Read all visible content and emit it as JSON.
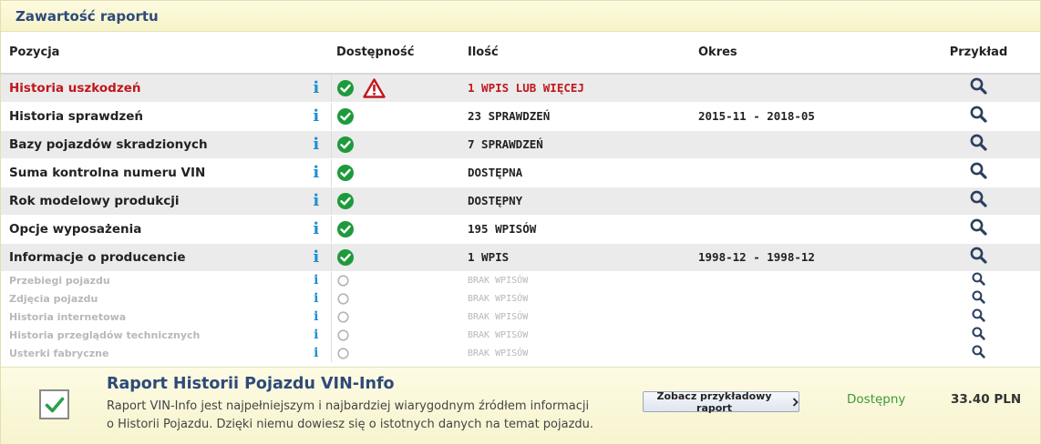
{
  "header": {
    "title": "Zawartość raportu"
  },
  "columns": {
    "position": "Pozycja",
    "availability": "Dostępność",
    "quantity": "Ilość",
    "period": "Okres",
    "example": "Przykład"
  },
  "rows": [
    {
      "name": "Historia uszkodzeń",
      "quantity": "1 WPIS LUB WIĘCEJ",
      "period": ""
    },
    {
      "name": "Historia sprawdzeń",
      "quantity": "23 SPRAWDZEŃ",
      "period": "2015-11 - 2018-05"
    },
    {
      "name": "Bazy pojazdów skradzionych",
      "quantity": "7 SPRAWDZEŃ",
      "period": ""
    },
    {
      "name": "Suma kontrolna numeru VIN",
      "quantity": "DOSTĘPNA",
      "period": ""
    },
    {
      "name": "Rok modelowy produkcji",
      "quantity": "DOSTĘPNY",
      "period": ""
    },
    {
      "name": "Opcje wyposażenia",
      "quantity": "195 WPISÓW",
      "period": ""
    },
    {
      "name": "Informacje o producencie",
      "quantity": "1 WPIS",
      "period": "1998-12 - 1998-12"
    },
    {
      "name": "Przebiegi pojazdu",
      "quantity": "BRAK WPISÓW",
      "period": ""
    },
    {
      "name": "Zdjęcia pojazdu",
      "quantity": "BRAK WPISÓW",
      "period": ""
    },
    {
      "name": "Historia internetowa",
      "quantity": "BRAK WPISÓW",
      "period": ""
    },
    {
      "name": "Historia przeglądów technicznych",
      "quantity": "BRAK WPISÓW",
      "period": ""
    },
    {
      "name": "Usterki fabryczne",
      "quantity": "BRAK WPISÓW",
      "period": ""
    }
  ],
  "footer": {
    "title": "Raport Historii Pojazdu VIN-Info",
    "desc_line1": "Raport VIN-Info jest najpełniejszym i najbardziej wiarygodnym źródłem informacji",
    "desc_line2": "o Historii Pojazdu. Dzięki niemu dowiesz się o istotnych danych na temat pojazdu.",
    "sample_button": "Zobacz przykładowy raport",
    "availability": "Dostępny",
    "price": "33.40 PLN"
  },
  "icons": {
    "info": "info-icon",
    "available": "check-circle-icon",
    "unavailable": "empty-circle-icon",
    "warning": "warning-triangle-icon",
    "example": "search-icon",
    "checkbox": "checkmark-icon",
    "button_arrow": "chevron-right-icon"
  },
  "colors": {
    "title": "#2e4a7a",
    "check_green": "#1e9a3c",
    "info_blue": "#1f8fd1",
    "alert_red": "#c0171c",
    "search": "#2b3f5f"
  }
}
